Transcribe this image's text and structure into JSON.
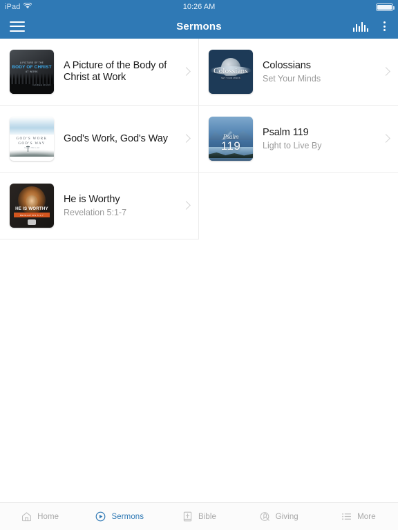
{
  "statusbar": {
    "device": "iPad",
    "wifi_icon": "wifi-icon",
    "time": "10:26 AM",
    "battery_icon": "battery-full-icon"
  },
  "navbar": {
    "menu_icon": "hamburger-menu-icon",
    "title": "Sermons",
    "equalizer_icon": "equalizer-icon",
    "overflow_icon": "kebab-menu-icon",
    "background_color": "#2f79b5"
  },
  "sermons": {
    "left_column": [
      {
        "title": "A Picture of the Body of Christ at Work",
        "subtitle": "",
        "thumbnail": "body-of-christ-artwork",
        "art": {
          "line1": "A PICTURE OF THE",
          "line2": "BODY OF CHRIST",
          "line3": "AT WORK",
          "credit": "Corinthians 12:12-31"
        },
        "chevron_icon": "chevron-right-icon"
      },
      {
        "title": "God's Work, God's Way",
        "subtitle": "",
        "thumbnail": "gods-work-gods-way-artwork",
        "art": {
          "line1": "GOD'S WORK",
          "line2": "GOD'S WAY",
          "line3": "Isaiah 55:1-13"
        },
        "chevron_icon": "chevron-right-icon"
      },
      {
        "title": "He is Worthy",
        "subtitle": "Revelation 5:1-7",
        "thumbnail": "he-is-worthy-artwork",
        "art": {
          "line1": "HE IS WORTHY",
          "line2": "REVELATION 5:1-7"
        },
        "chevron_icon": "chevron-right-icon"
      }
    ],
    "right_column": [
      {
        "title": "Colossians",
        "subtitle": "Set Your Minds",
        "thumbnail": "colossians-artwork",
        "art": {
          "line1": "Colossians",
          "line2": "SET YOUR MINDS"
        },
        "chevron_icon": "chevron-right-icon"
      },
      {
        "title": "Psalm 119",
        "subtitle": "Light to Live By",
        "thumbnail": "psalm-119-artwork",
        "art": {
          "line1": "Psalm",
          "line2": "119"
        },
        "chevron_icon": "chevron-right-icon"
      }
    ]
  },
  "tabbar": {
    "accent_color": "#2f79b5",
    "inactive_color": "#a8a8a8",
    "items": [
      {
        "label": "Home",
        "icon": "home-icon",
        "active": false
      },
      {
        "label": "Sermons",
        "icon": "play-circle-icon",
        "active": true
      },
      {
        "label": "Bible",
        "icon": "bible-book-icon",
        "active": false
      },
      {
        "label": "Giving",
        "icon": "giving-hand-icon",
        "active": false
      },
      {
        "label": "More",
        "icon": "list-more-icon",
        "active": false
      }
    ]
  }
}
